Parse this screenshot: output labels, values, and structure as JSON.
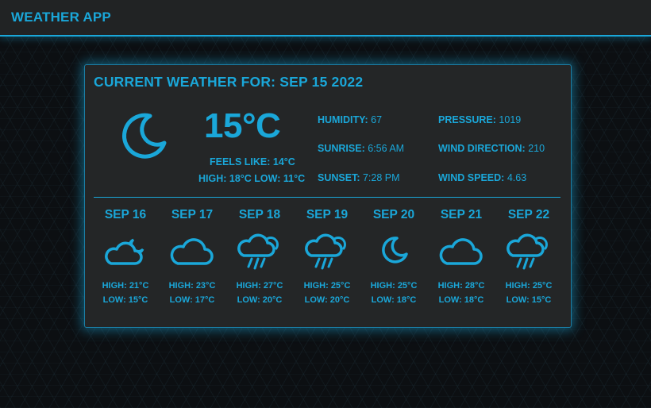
{
  "app": {
    "title": "WEATHER APP"
  },
  "current": {
    "title": "CURRENT WEATHER FOR: SEP 15 2022",
    "icon": "moon-icon",
    "temp": "15°C",
    "feels": "FEELS LIKE: 14°C",
    "hilo": "HIGH: 18°C LOW: 11°C",
    "stats": {
      "humidity": {
        "label": "HUMIDITY:",
        "value": "67"
      },
      "sunrise": {
        "label": "SUNRISE:",
        "value": "6:56 AM"
      },
      "sunset": {
        "label": "SUNSET:",
        "value": "7:28 PM"
      },
      "pressure": {
        "label": "PRESSURE:",
        "value": "1019"
      },
      "wind_direction": {
        "label": "WIND DIRECTION:",
        "value": "210"
      },
      "wind_speed": {
        "label": "WIND SPEED:",
        "value": "4.63"
      }
    }
  },
  "forecast": [
    {
      "date": "SEP 16",
      "icon": "cloud-moon-icon",
      "high": "HIGH: 21°C",
      "low": "LOW: 15°C"
    },
    {
      "date": "SEP 17",
      "icon": "cloud-icon",
      "high": "HIGH: 23°C",
      "low": "LOW: 17°C"
    },
    {
      "date": "SEP 18",
      "icon": "rain-cloud-icon",
      "high": "HIGH: 27°C",
      "low": "LOW: 20°C"
    },
    {
      "date": "SEP 19",
      "icon": "rain-cloud-icon",
      "high": "HIGH: 25°C",
      "low": "LOW: 20°C"
    },
    {
      "date": "SEP 20",
      "icon": "moon-icon",
      "high": "HIGH: 25°C",
      "low": "LOW: 18°C"
    },
    {
      "date": "SEP 21",
      "icon": "cloud-icon",
      "high": "HIGH: 28°C",
      "low": "LOW: 18°C"
    },
    {
      "date": "SEP 22",
      "icon": "rain-cloud-icon",
      "high": "HIGH: 25°C",
      "low": "LOW: 15°C"
    }
  ],
  "colors": {
    "accent": "#1aa7d9",
    "card": "#242627",
    "topbar": "#212324",
    "background": "#0c0f12"
  }
}
